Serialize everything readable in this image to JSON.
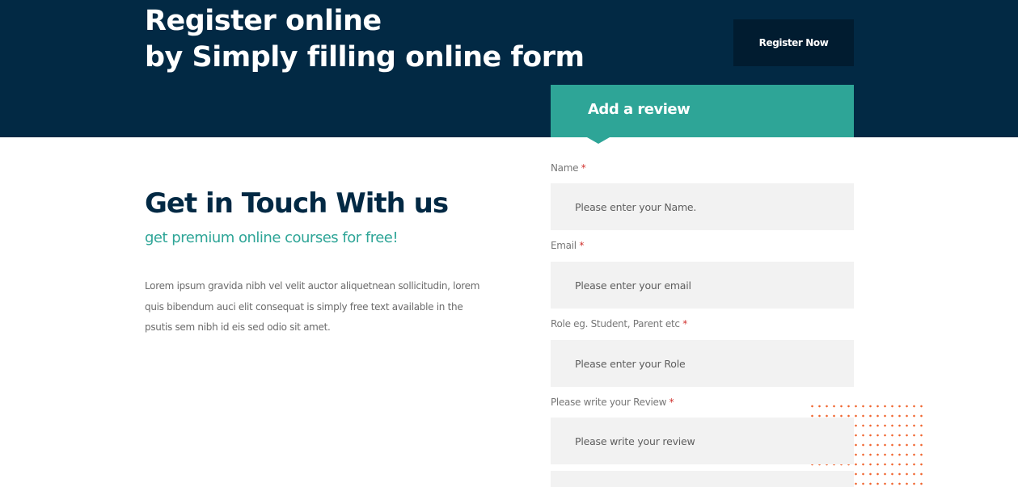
{
  "banner": {
    "title_line1": "Register online",
    "title_line2": "by Simply filling online form",
    "register_button": "Register Now",
    "background_color": "#022944"
  },
  "review_panel": {
    "title": "Add a review",
    "accent_color": "#2ea597"
  },
  "contact": {
    "title": "Get in Touch With us",
    "subtitle": "get premium online courses for free!",
    "body": "Lorem ipsum gravida nibh vel velit auctor aliquetnean sollicitudin, lorem quis bibendum auci elit consequat is simply free text available in the psutis sem nibh id eis sed odio sit amet."
  },
  "form": {
    "required_marker": "*",
    "fields": [
      {
        "label": "Name",
        "placeholder": "Please enter your Name.",
        "value": ""
      },
      {
        "label": "Email",
        "placeholder": "Please enter your email",
        "value": ""
      },
      {
        "label": "Role eg. Student, Parent etc",
        "placeholder": "Please enter your Role",
        "value": ""
      },
      {
        "label": "Please write your Review",
        "placeholder": "Please write your review",
        "value": ""
      }
    ]
  },
  "decor": {
    "dot_pattern_color": "#f0652f"
  }
}
